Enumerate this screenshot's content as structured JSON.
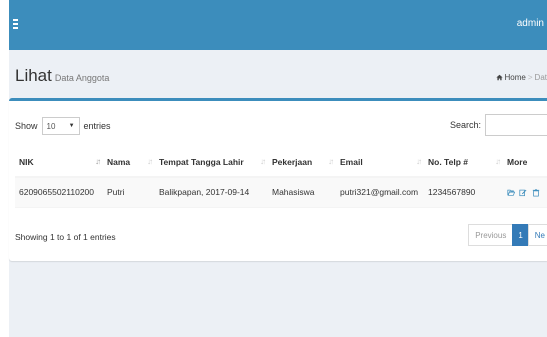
{
  "colors": {
    "topbar": "#3c8dbc",
    "accent": "#337ab7",
    "icon": "#3c8dbc"
  },
  "header": {
    "menu_icon": "hamburger-icon",
    "user": "admin"
  },
  "page": {
    "title": "Lihat",
    "subtitle": "Data Anggota"
  },
  "breadcrumb": {
    "home_icon": "home-icon",
    "home": "Home",
    "sep": ">",
    "current": "Dat"
  },
  "controls": {
    "show_label": "Show",
    "entries_value": "10",
    "entries_label": "entries",
    "search_label": "Search:",
    "search_value": ""
  },
  "table": {
    "columns": [
      "NIK",
      "Nama",
      "Tempat Tangga Lahir",
      "Pekerjaan",
      "Email",
      "No. Telp #",
      "More"
    ],
    "rows": [
      {
        "nik": "6209065502110200",
        "nama": "Putri",
        "ttl": "Balikpapan, 2017-09-14",
        "pekerjaan": "Mahasiswa",
        "email": "putri321@gmail.com",
        "telp": "1234567890",
        "actions": [
          "folder-open-icon",
          "edit-icon",
          "trash-icon"
        ]
      }
    ]
  },
  "footer": {
    "info": "Showing 1 to 1 of 1 entries",
    "prev": "Previous",
    "page": "1",
    "next": "Ne"
  }
}
